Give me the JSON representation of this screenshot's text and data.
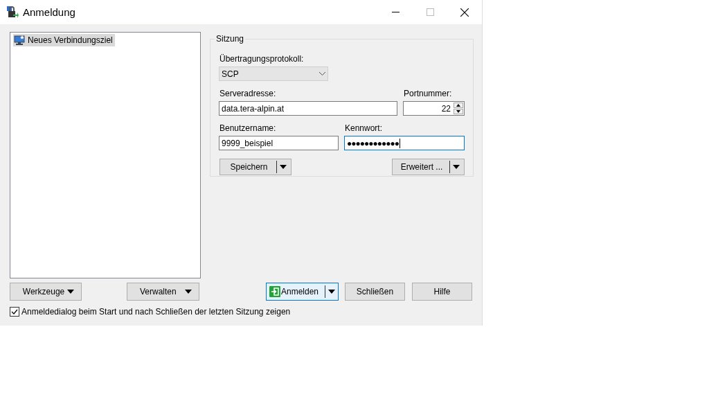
{
  "window": {
    "title": "Anmeldung"
  },
  "sites": [
    {
      "label": "Neues Verbindungsziel",
      "selected": true
    }
  ],
  "session": {
    "title": "Sitzung",
    "protocol": {
      "label": "Übertragungsprotokoll:",
      "value": "SCP"
    },
    "host": {
      "label": "Serveradresse:",
      "value": "data.tera-alpin.at",
      "focused": false
    },
    "port": {
      "label": "Portnummer:",
      "value": "22"
    },
    "user": {
      "label": "Benutzername:",
      "value": "9999_beispiel",
      "focused": false
    },
    "password": {
      "label": "Kennwort:",
      "value": "●●●●●●●●●●●●",
      "focused": true
    },
    "buttons": [
      {
        "label": "Speichern",
        "kind": "split"
      },
      {
        "label": "Erweitert ...",
        "kind": "split"
      }
    ]
  },
  "left_buttons": [
    {
      "label": "Werkzeuge",
      "kind": "menu"
    },
    {
      "label": "Verwalten",
      "kind": "menu"
    }
  ],
  "right_buttons": [
    {
      "label": "Anmelden",
      "kind": "split",
      "default": true
    },
    {
      "label": "Schließen",
      "kind": "plain",
      "default": false
    },
    {
      "label": "Hilfe",
      "kind": "plain",
      "default": false
    }
  ],
  "show_dialog": {
    "label": "Anmeldedialog beim Start und nach Schließen der letzten Sitzung zeigen",
    "checked": true
  }
}
